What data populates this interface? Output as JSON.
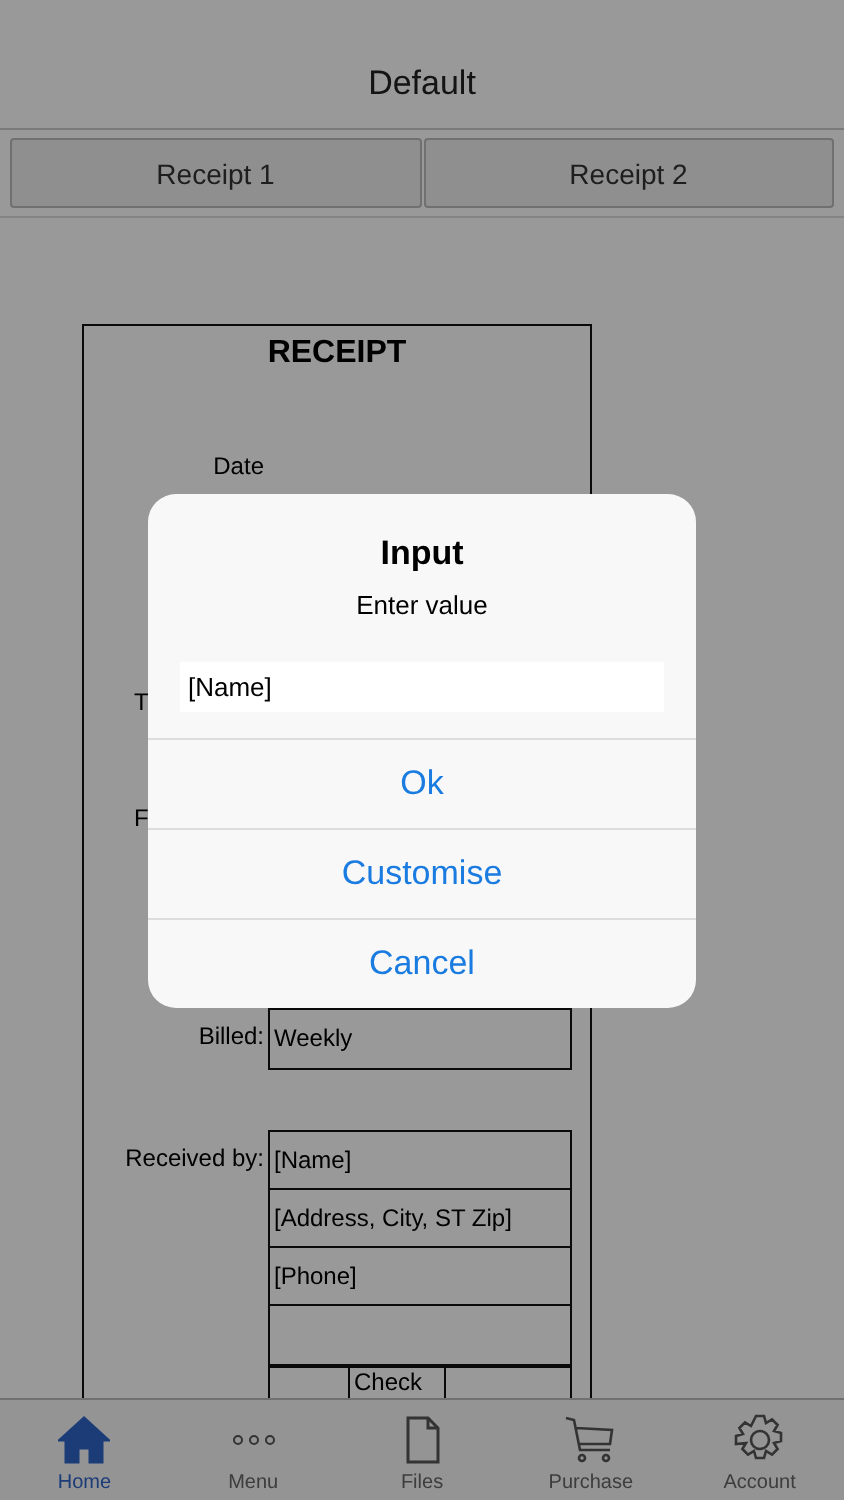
{
  "nav_title": "Default",
  "segments": [
    {
      "label": "Receipt 1"
    },
    {
      "label": "Receipt 2"
    }
  ],
  "receipt": {
    "title": "RECEIPT",
    "rows": [
      {
        "kind": "label",
        "label": "Date"
      },
      {
        "kind": "fragment",
        "label": "T"
      },
      {
        "kind": "fragment",
        "label": "F"
      },
      {
        "kind": "boxed",
        "label": "Billed:",
        "values": [
          "Weekly"
        ]
      },
      {
        "kind": "boxed",
        "label": "Received by:",
        "values": [
          "[Name]",
          "[Address, City, ST  Zip]",
          "[Phone]"
        ]
      }
    ],
    "table_row_text": "Check"
  },
  "dialog": {
    "title": "Input",
    "message": "Enter value",
    "value": "[Name]",
    "buttons": [
      "Ok",
      "Customise",
      "Cancel"
    ]
  },
  "tab_bar": [
    {
      "label": "Home",
      "selected": true
    },
    {
      "label": "Menu",
      "selected": false
    },
    {
      "label": "Files",
      "selected": false
    },
    {
      "label": "Purchase",
      "selected": false
    },
    {
      "label": "Account",
      "selected": false
    }
  ]
}
